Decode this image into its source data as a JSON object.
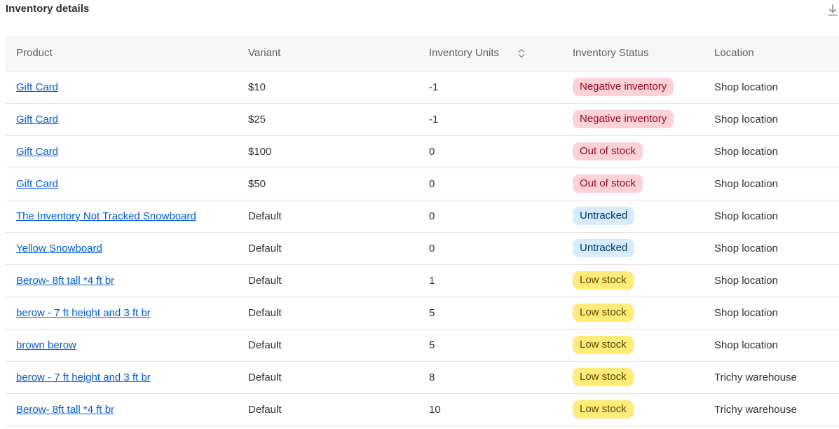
{
  "header": {
    "title": "Inventory details",
    "download_icon": "download-icon"
  },
  "table": {
    "columns": {
      "product": "Product",
      "variant": "Variant",
      "units": "Inventory Units",
      "status": "Inventory Status",
      "location": "Location"
    },
    "sort_icon": "sort-icon",
    "rows": [
      {
        "product": "Gift Card",
        "variant": "$10",
        "units": "-1",
        "status": "Negative inventory",
        "status_type": "negative",
        "location": "Shop location"
      },
      {
        "product": "Gift Card",
        "variant": "$25",
        "units": "-1",
        "status": "Negative inventory",
        "status_type": "negative",
        "location": "Shop location"
      },
      {
        "product": "Gift Card",
        "variant": "$100",
        "units": "0",
        "status": "Out of stock",
        "status_type": "out",
        "location": "Shop location"
      },
      {
        "product": "Gift Card",
        "variant": "$50",
        "units": "0",
        "status": "Out of stock",
        "status_type": "out",
        "location": "Shop location"
      },
      {
        "product": "The Inventory Not Tracked Snowboard",
        "variant": "Default",
        "units": "0",
        "status": "Untracked",
        "status_type": "untracked",
        "location": "Shop location"
      },
      {
        "product": "Yellow Snowboard",
        "variant": "Default",
        "units": "0",
        "status": "Untracked",
        "status_type": "untracked",
        "location": "Shop location"
      },
      {
        "product": "Berow- 8ft tall *4 ft br",
        "variant": "Default",
        "units": "1",
        "status": "Low stock",
        "status_type": "low",
        "location": "Shop location"
      },
      {
        "product": "berow - 7 ft height and 3 ft br",
        "variant": "Default",
        "units": "5",
        "status": "Low stock",
        "status_type": "low",
        "location": "Shop location"
      },
      {
        "product": "brown berow",
        "variant": "Default",
        "units": "5",
        "status": "Low stock",
        "status_type": "low",
        "location": "Shop location"
      },
      {
        "product": "berow - 7 ft height and 3 ft br",
        "variant": "Default",
        "units": "8",
        "status": "Low stock",
        "status_type": "low",
        "location": "Trichy warehouse"
      },
      {
        "product": "Berow- 8ft tall *4 ft br",
        "variant": "Default",
        "units": "10",
        "status": "Low stock",
        "status_type": "low",
        "location": "Trichy warehouse"
      }
    ]
  },
  "colors": {
    "link": "#005bd3",
    "negative_bg": "#fed1d7",
    "untracked_bg": "#d5ebff",
    "low_bg": "#ffeb78"
  }
}
